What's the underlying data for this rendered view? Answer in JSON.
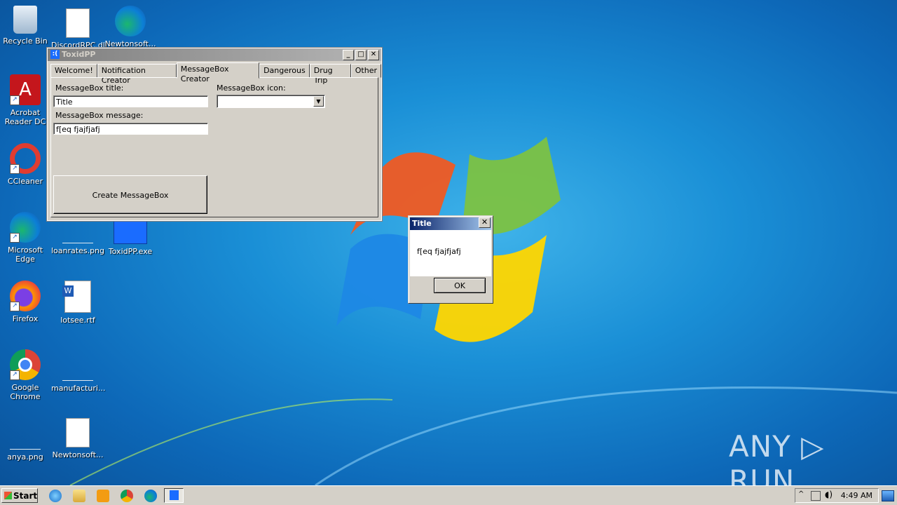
{
  "desktop": {
    "icons": [
      {
        "label": "Recycle Bin"
      },
      {
        "label": "DiscordRPC.dll"
      },
      {
        "label": "Newtonsoft..."
      },
      {
        "label": "Acrobat Reader DC"
      },
      {
        "label": "CCleaner"
      },
      {
        "label": "Microsoft Edge"
      },
      {
        "label": "loanrates.png"
      },
      {
        "label": "ToxidPP.exe"
      },
      {
        "label": "Firefox"
      },
      {
        "label": "lotsee.rtf"
      },
      {
        "label": "Google Chrome"
      },
      {
        "label": "manufacturi..."
      },
      {
        "label": "anya.png"
      },
      {
        "label": "Newtonsoft..."
      }
    ]
  },
  "window": {
    "title": "ToxidPP",
    "tabs": [
      "Welcome!",
      "Notification Creator",
      "MessageBox Creator",
      "Dangerous",
      "Drug Trip",
      "Other"
    ],
    "active_tab": "MessageBox Creator",
    "mb_title_label": "MessageBox title:",
    "mb_title_value": "Title",
    "mb_icon_label": "MessageBox icon:",
    "mb_icon_value": "",
    "mb_message_label": "MessageBox message:",
    "mb_message_value": "f[eq fjajfjafj",
    "create_button": "Create MessageBox"
  },
  "messagebox": {
    "title": "Title",
    "text": "f[eq fjajfjafj",
    "ok": "OK",
    "close": "✕"
  },
  "taskbar": {
    "start_label": "Start",
    "clock": "4:49 AM"
  },
  "watermark": "ANY ▷ RUN"
}
